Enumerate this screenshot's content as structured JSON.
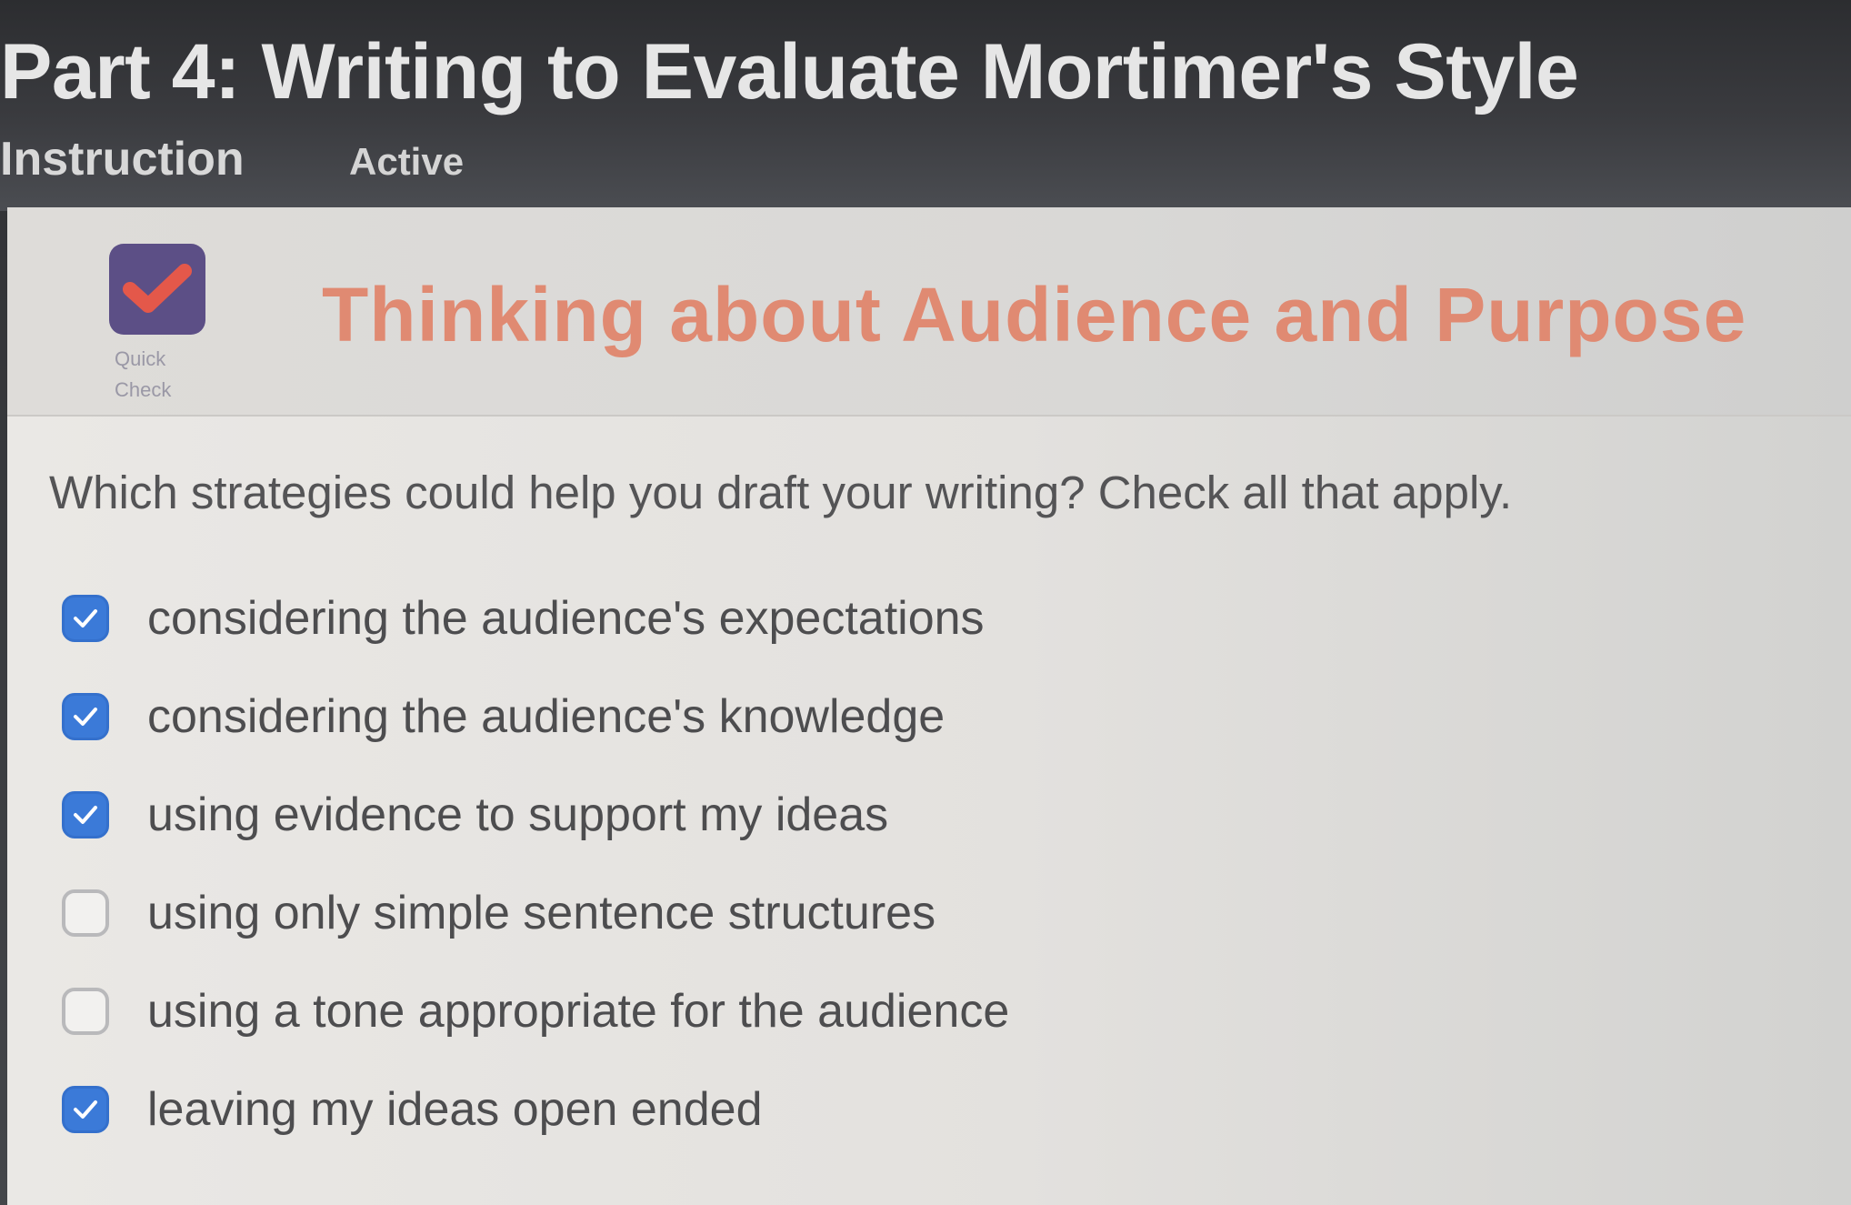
{
  "header": {
    "lesson_title": "Part 4: Writing to Evaluate Mortimer's Style",
    "tab_label": "Instruction",
    "status": "Active"
  },
  "banner": {
    "badge_icon": "checkmark-icon",
    "badge_label_line1": "Quick",
    "badge_label_line2": "Check",
    "title": "Thinking about Audience and Purpose"
  },
  "question": {
    "prompt": "Which strategies could help you draft your writing? Check all that apply.",
    "options": [
      {
        "label": "considering the audience's expectations",
        "checked": true
      },
      {
        "label": "considering the audience's knowledge",
        "checked": true
      },
      {
        "label": "using evidence to support my ideas",
        "checked": true
      },
      {
        "label": "using only simple sentence structures",
        "checked": false
      },
      {
        "label": "using a tone appropriate for the audience",
        "checked": false
      },
      {
        "label": "leaving my ideas open ended",
        "checked": true
      }
    ]
  },
  "colors": {
    "accent_title": "#e08a72",
    "badge_bg": "#5c4f86",
    "badge_check": "#e4584a",
    "checkbox_checked": "#3b7ad8"
  }
}
